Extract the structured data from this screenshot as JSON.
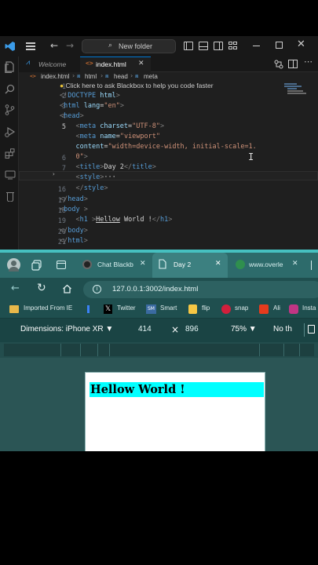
{
  "vscode": {
    "title_search": "New folder",
    "tabs": [
      {
        "label": "Welcome"
      },
      {
        "label": "index.html"
      }
    ],
    "breadcrumb": [
      "index.html",
      "html",
      "head",
      "meta"
    ],
    "hint": "Click here to ask Blackbox to help you code faster",
    "lines": [
      {
        "n": "1"
      },
      {
        "n": "2"
      },
      {
        "n": "3"
      },
      {
        "n": "4"
      },
      {
        "n": "5"
      },
      {
        "n": ""
      },
      {
        "n": ""
      },
      {
        "n": "6"
      },
      {
        "n": "7"
      },
      {
        "n": "16"
      },
      {
        "n": "17"
      },
      {
        "n": "18"
      },
      {
        "n": "19"
      },
      {
        "n": "20"
      },
      {
        "n": "21"
      }
    ]
  },
  "browser": {
    "tabs": [
      {
        "label": "Chat Blackb"
      },
      {
        "label": "Day 2"
      },
      {
        "label": "www.overle"
      }
    ],
    "url": "127.0.0.1:3002/index.html",
    "bookmarks": [
      "Imported From IE",
      "Twitter",
      "Smart",
      "flip",
      "snap",
      "Ali",
      "Insta"
    ],
    "devtools": {
      "device": "Dimensions: iPhone XR",
      "width": "414",
      "times": "×",
      "height": "896",
      "zoom": "75%",
      "throttle": "No th"
    },
    "page_heading": "Hellow World !"
  },
  "colors": {
    "heading_bg": "#00ffff",
    "browser_accent": "#46c0c0"
  }
}
